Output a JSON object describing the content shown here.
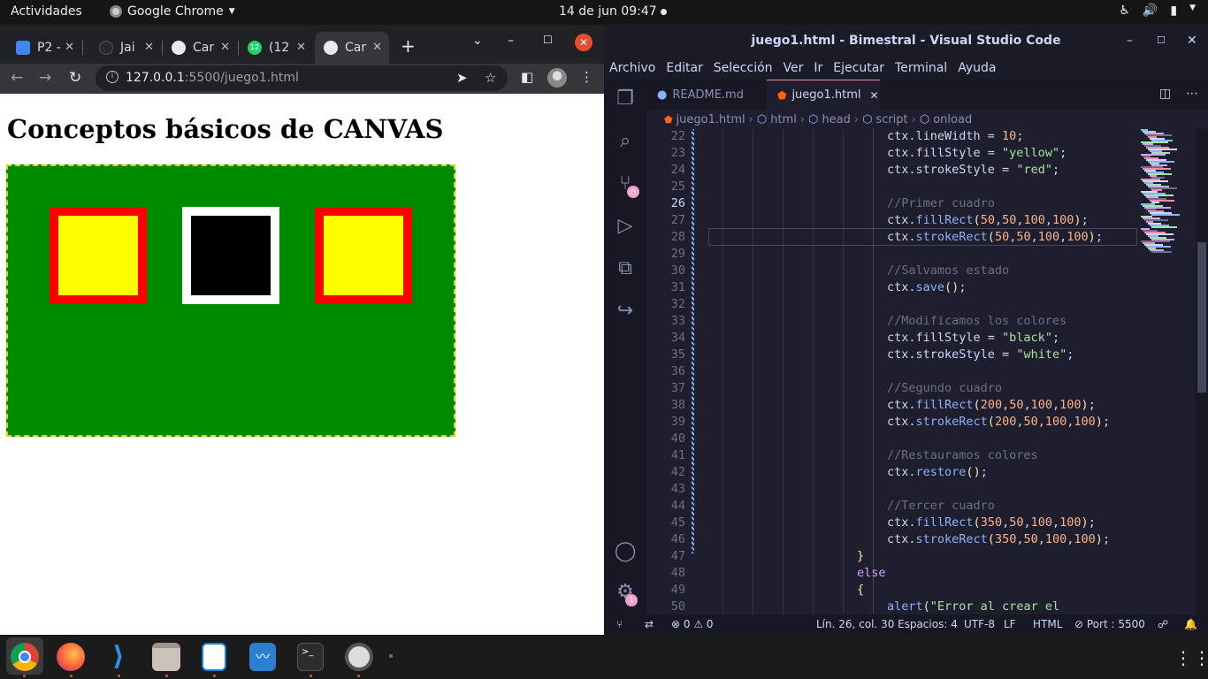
{
  "topbar": {
    "activities": "Actividades",
    "app_name": "Google Chrome",
    "clock": "14 de jun  09:47"
  },
  "chrome": {
    "tabs": [
      {
        "label": "P2 -",
        "icon": "classroom-icon",
        "color": "#4285f4"
      },
      {
        "label": "Jai",
        "icon": "github-icon",
        "color": "#24292e"
      },
      {
        "label": "Car",
        "icon": "globe-icon",
        "color": "#e8eaed"
      },
      {
        "label": "(12",
        "icon": "whatsapp-icon",
        "color": "#25d366",
        "badge": "12"
      },
      {
        "label": "Car",
        "icon": "globe-icon",
        "color": "#e8eaed",
        "active": true
      }
    ],
    "url_host": "127.0.0.1",
    "url_path": ":5500/juego1.html",
    "page_heading": "Conceptos básicos de CANVAS",
    "canvas": {
      "background": "#008a00",
      "squares": [
        {
          "fill": "yellow",
          "stroke": "red"
        },
        {
          "fill": "black",
          "stroke": "white"
        },
        {
          "fill": "yellow",
          "stroke": "red"
        }
      ]
    }
  },
  "vscode": {
    "window_title": "juego1.html - Bimestral - Visual Studio Code",
    "menu": [
      "Archivo",
      "Editar",
      "Selección",
      "Ver",
      "Ir",
      "Ejecutar",
      "Terminal",
      "Ayuda"
    ],
    "tabs": [
      {
        "label": "README.md",
        "icon": "info-icon"
      },
      {
        "label": "juego1.html",
        "icon": "html5-icon",
        "active": true
      }
    ],
    "breadcrumb": [
      "juego1.html",
      "html",
      "head",
      "script",
      "onload"
    ],
    "source_control_badge": "",
    "settings_badge": "1",
    "status": {
      "problems_errors": "0",
      "problems_warnings": "0",
      "position": "Lín. 26, col. 30",
      "spaces": "Espacios: 4",
      "encoding": "UTF-8",
      "eol": "LF",
      "language": "HTML",
      "port": "Port : 5500"
    },
    "code_lines": [
      {
        "n": "22",
        "code": "ctx.lineWidth = 10;"
      },
      {
        "n": "23",
        "code": "ctx.fillStyle = \"yellow\";"
      },
      {
        "n": "24",
        "code": "ctx.strokeStyle = \"red\";"
      },
      {
        "n": "25",
        "code": ""
      },
      {
        "n": "26",
        "code": "//Primer cuadro"
      },
      {
        "n": "27",
        "code": "ctx.fillRect(50,50,100,100);"
      },
      {
        "n": "28",
        "code": "ctx.strokeRect(50,50,100,100);"
      },
      {
        "n": "29",
        "code": ""
      },
      {
        "n": "30",
        "code": "//Salvamos estado"
      },
      {
        "n": "31",
        "code": "ctx.save();"
      },
      {
        "n": "32",
        "code": ""
      },
      {
        "n": "33",
        "code": "//Modificamos los colores"
      },
      {
        "n": "34",
        "code": "ctx.fillStyle = \"black\";"
      },
      {
        "n": "35",
        "code": "ctx.strokeStyle = \"white\";"
      },
      {
        "n": "36",
        "code": ""
      },
      {
        "n": "37",
        "code": "//Segundo cuadro"
      },
      {
        "n": "38",
        "code": "ctx.fillRect(200,50,100,100);"
      },
      {
        "n": "39",
        "code": "ctx.strokeRect(200,50,100,100);"
      },
      {
        "n": "40",
        "code": ""
      },
      {
        "n": "41",
        "code": "//Restauramos colores"
      },
      {
        "n": "42",
        "code": "ctx.restore();"
      },
      {
        "n": "43",
        "code": ""
      },
      {
        "n": "44",
        "code": "//Tercer cuadro"
      },
      {
        "n": "45",
        "code": "ctx.fillRect(350,50,100,100);"
      },
      {
        "n": "46",
        "code": "ctx.strokeRect(350,50,100,100);"
      },
      {
        "n": "47",
        "code": "}"
      },
      {
        "n": "48",
        "code": "else"
      },
      {
        "n": "49",
        "code": "{"
      },
      {
        "n": "50",
        "code": "alert(\"Error al crear el"
      }
    ],
    "current_line": "26"
  },
  "dock": [
    {
      "app": "chrome",
      "icon": "chrome-icon",
      "running": true
    },
    {
      "app": "firefox",
      "icon": "firefox-icon",
      "running": true
    },
    {
      "app": "vscode",
      "icon": "vscode-icon",
      "running": true
    },
    {
      "app": "files",
      "icon": "folder-icon",
      "running": true
    },
    {
      "app": "writer",
      "icon": "document-icon",
      "running": true
    },
    {
      "app": "monitor",
      "icon": "system-monitor-icon",
      "running": false
    },
    {
      "app": "terminal",
      "icon": "terminal-icon",
      "running": true
    },
    {
      "app": "software-updater",
      "icon": "updater-icon",
      "running": true
    }
  ]
}
